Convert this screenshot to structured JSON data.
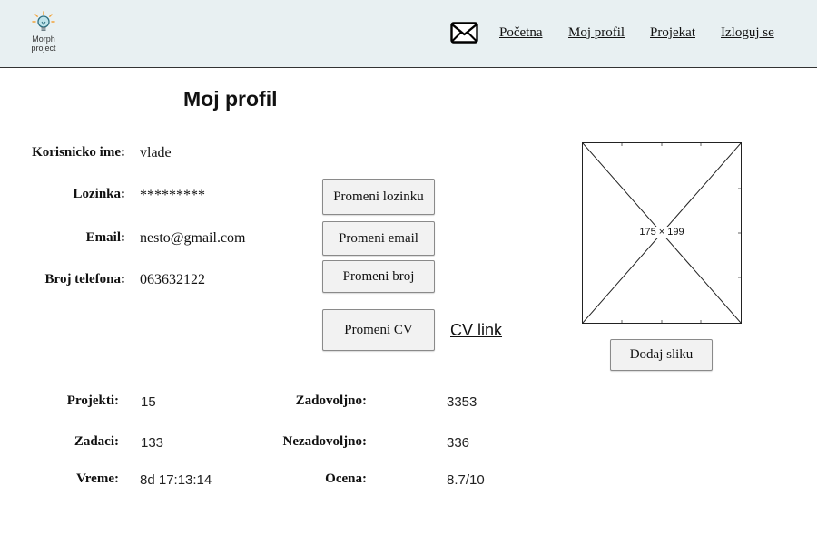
{
  "header": {
    "logo_text_line1": "Morph",
    "logo_text_line2": "project",
    "mail_icon": "envelope-icon",
    "nav": {
      "home": "Početna",
      "profile": "Moj profil",
      "project": "Projekat",
      "logout": "Izloguj se"
    }
  },
  "page": {
    "title": "Moj profil"
  },
  "profile": {
    "username_label": "Korisnicko ime:",
    "username": "vlade",
    "password_label": "Lozinka:",
    "password": "*********",
    "email_label": "Email:",
    "email": "nesto@gmail.com",
    "phone_label": "Broj telefona:",
    "phone": "063632122"
  },
  "buttons": {
    "change_password": "Promeni lozinku",
    "change_email": "Promeni email",
    "change_phone": "Promeni broj",
    "change_cv": "Promeni CV",
    "cv_link": "CV link",
    "add_image": "Dodaj sliku"
  },
  "image_placeholder": {
    "label": "175 × 199"
  },
  "stats": {
    "projects_label": "Projekti:",
    "projects": "15",
    "tasks_label": "Zadaci:",
    "tasks": "133",
    "time_label": "Vreme:",
    "time": "8d 17:13:14",
    "satisfied_label": "Zadovoljno:",
    "satisfied": "3353",
    "unsatisfied_label": "Nezadovoljno:",
    "unsatisfied": "336",
    "rating_label": "Ocena:",
    "rating": "8.7/10"
  }
}
